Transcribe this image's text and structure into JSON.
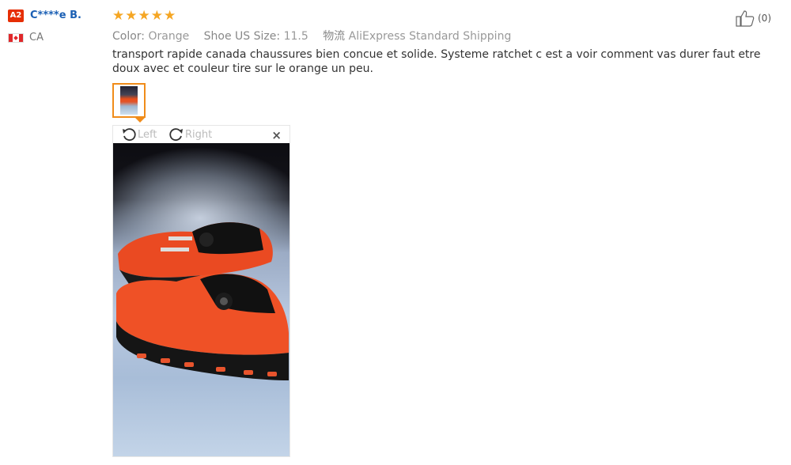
{
  "reviewer": {
    "badge": "A2",
    "name": "C****e B.",
    "country": "CA",
    "flag": "canada-flag-icon"
  },
  "rating": {
    "stars": "★★★★★",
    "value": 5,
    "max": 5,
    "color": "#f5a623"
  },
  "attributes": {
    "color_label": "Color:",
    "color_value": "Orange",
    "size_label": "Shoe US Size:",
    "size_value": "11.5",
    "shipping_label": "物流",
    "shipping_value": "AliExpress Standard Shipping"
  },
  "review_text": "transport rapide canada chaussures bien concue et solide. Systeme ratchet c est a voir comment vas durer faut etre doux avec et couleur tire sur le orange un peu.",
  "viewer": {
    "rotate_left_label": "Left",
    "rotate_right_label": "Right",
    "close_label": "×"
  },
  "helpful": {
    "count": "(0)",
    "icon": "thumbs-up-icon"
  },
  "colors": {
    "badge": "#e62e04",
    "name": "#1a5fb4",
    "thumb_border": "#f08c1a"
  }
}
